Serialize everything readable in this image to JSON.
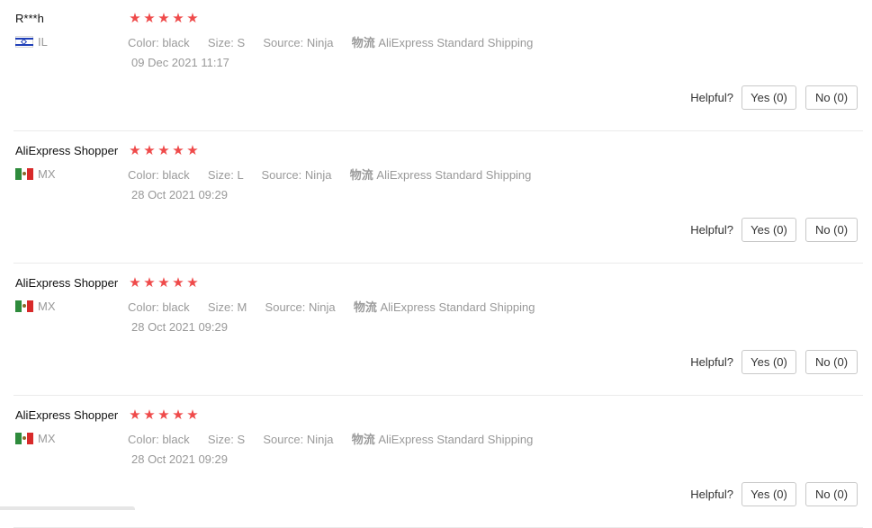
{
  "reviews": [
    {
      "user": "R***h",
      "country_code": "IL",
      "flag": "israel-flag-icon",
      "rating": 5,
      "attrs": {
        "color_label": "Color:",
        "color": "black",
        "size_label": "Size:",
        "size": "S",
        "source_label": "Source:",
        "source": "Ninja",
        "logistics_label": "物流",
        "logistics": "AliExpress Standard Shipping"
      },
      "date": "09 Dec 2021 11:17",
      "helpful_label": "Helpful?",
      "yes_label": "Yes (0)",
      "no_label": "No (0)"
    },
    {
      "user": "AliExpress Shopper",
      "country_code": "MX",
      "flag": "mexico-flag-icon",
      "rating": 5,
      "attrs": {
        "color_label": "Color:",
        "color": "black",
        "size_label": "Size:",
        "size": "L",
        "source_label": "Source:",
        "source": "Ninja",
        "logistics_label": "物流",
        "logistics": "AliExpress Standard Shipping"
      },
      "date": "28 Oct 2021 09:29",
      "helpful_label": "Helpful?",
      "yes_label": "Yes (0)",
      "no_label": "No (0)"
    },
    {
      "user": "AliExpress Shopper",
      "country_code": "MX",
      "flag": "mexico-flag-icon",
      "rating": 5,
      "attrs": {
        "color_label": "Color:",
        "color": "black",
        "size_label": "Size:",
        "size": "M",
        "source_label": "Source:",
        "source": "Ninja",
        "logistics_label": "物流",
        "logistics": "AliExpress Standard Shipping"
      },
      "date": "28 Oct 2021 09:29",
      "helpful_label": "Helpful?",
      "yes_label": "Yes (0)",
      "no_label": "No (0)"
    },
    {
      "user": "AliExpress Shopper",
      "country_code": "MX",
      "flag": "mexico-flag-icon",
      "rating": 5,
      "attrs": {
        "color_label": "Color:",
        "color": "black",
        "size_label": "Size:",
        "size": "S",
        "source_label": "Source:",
        "source": "Ninja",
        "logistics_label": "物流",
        "logistics": "AliExpress Standard Shipping"
      },
      "date": "28 Oct 2021 09:29",
      "helpful_label": "Helpful?",
      "yes_label": "Yes (0)",
      "no_label": "No (0)"
    }
  ],
  "colors": {
    "star": "#ef4a4a",
    "muted_text": "#999999",
    "divider": "#ebebeb"
  }
}
